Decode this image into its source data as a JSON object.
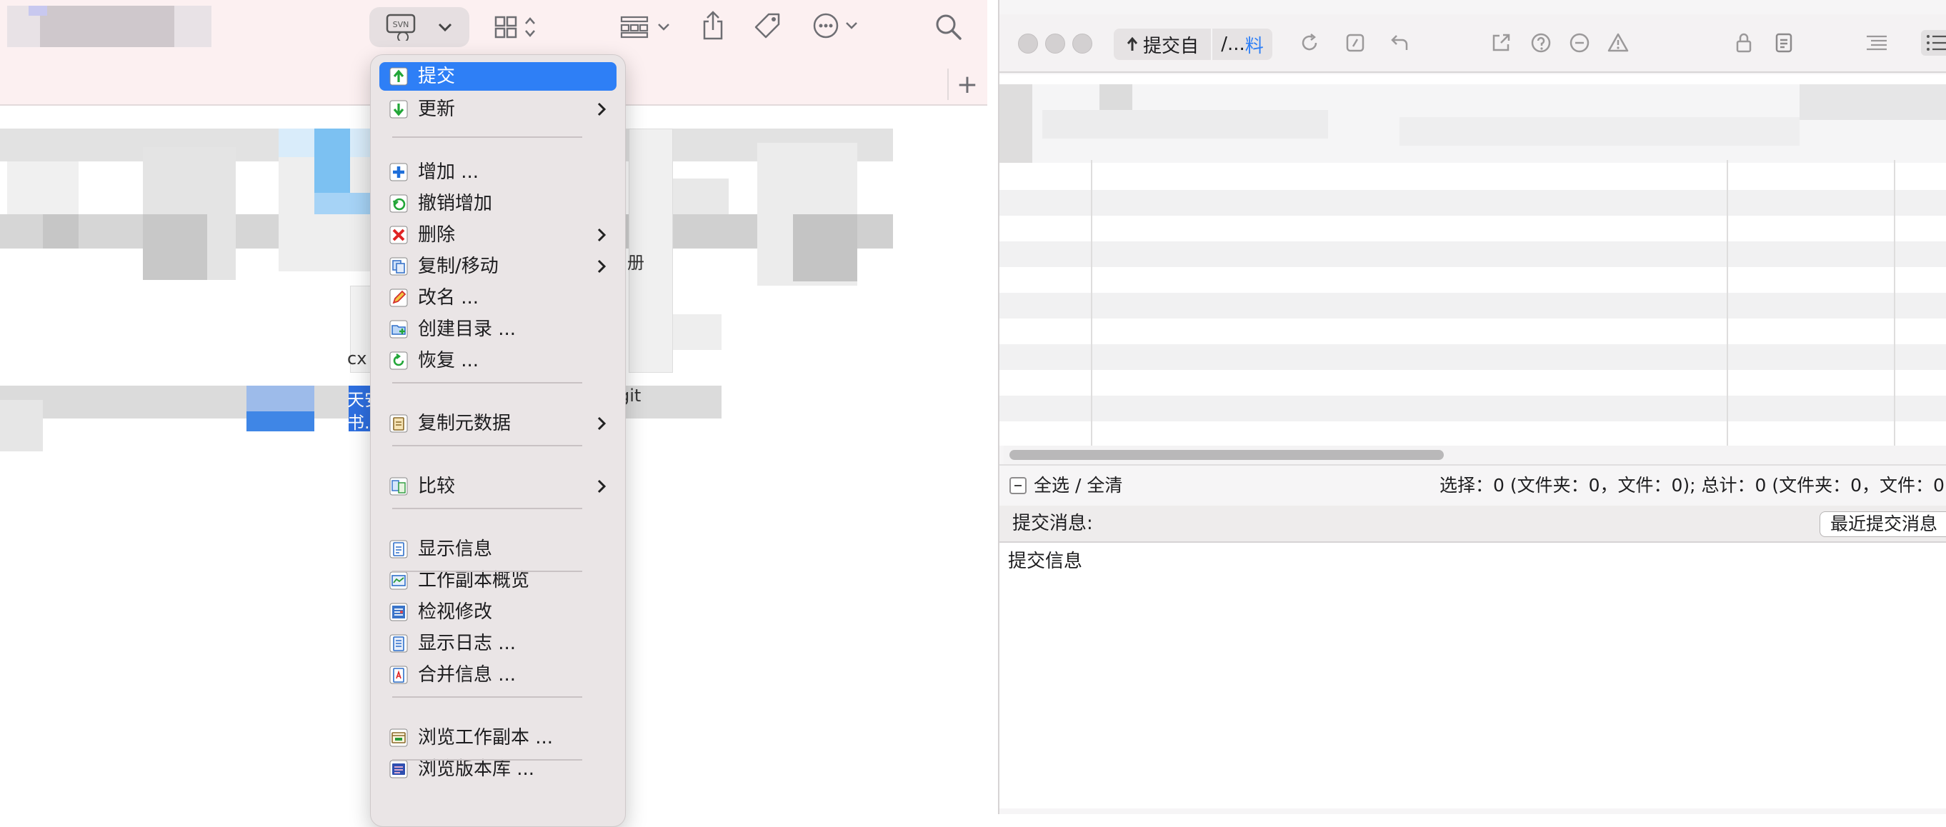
{
  "svn_menu": {
    "items": [
      {
        "label": "提交",
        "icon": "commit-up-arrow-icon",
        "submenu": false,
        "selected": true
      },
      {
        "label": "更新",
        "icon": "update-down-arrow-icon",
        "submenu": true
      },
      {
        "label": "增加 ...",
        "icon": "add-plus-icon",
        "submenu": false
      },
      {
        "label": "撤销增加",
        "icon": "undo-add-icon",
        "submenu": false
      },
      {
        "label": "删除",
        "icon": "delete-x-icon",
        "submenu": true
      },
      {
        "label": "复制/移动",
        "icon": "copy-move-icon",
        "submenu": true
      },
      {
        "label": "改名 ...",
        "icon": "rename-pencil-icon",
        "submenu": false
      },
      {
        "label": "创建目录 ...",
        "icon": "create-folder-icon",
        "submenu": false
      },
      {
        "label": "恢复 ...",
        "icon": "revert-icon",
        "submenu": false
      },
      {
        "label": "复制元数据",
        "icon": "copy-metadata-icon",
        "submenu": true
      },
      {
        "label": "比较",
        "icon": "compare-icon",
        "submenu": true
      },
      {
        "label": "显示信息",
        "icon": "show-info-icon",
        "submenu": false
      },
      {
        "label": "工作副本概览",
        "icon": "working-copy-overview-icon",
        "submenu": false
      },
      {
        "label": "检视修改",
        "icon": "review-changes-icon",
        "submenu": false
      },
      {
        "label": "显示日志 ...",
        "icon": "show-log-icon",
        "submenu": false
      },
      {
        "label": "合并信息 ...",
        "icon": "merge-info-icon",
        "submenu": false
      },
      {
        "label": "浏览工作副本 ...",
        "icon": "browse-working-copy-icon",
        "submenu": false
      },
      {
        "label": "浏览版本库 ...",
        "icon": "browse-repository-icon",
        "submenu": false
      }
    ]
  },
  "finder": {
    "svn_button_icon": "svn-badge-icon",
    "toolbar_icons": [
      "view-grid-icon",
      "group-by-icon",
      "share-icon",
      "tag-icon",
      "more-actions-icon",
      "search-icon"
    ],
    "new_tab_label": "+",
    "visible_fragments": [
      "天安",
      "书.",
      "册",
      "cx",
      "git"
    ]
  },
  "commit_window": {
    "commit_from_label": "提交自",
    "path_prefix": "/...",
    "path_link": "料",
    "select_all_label": "全选 / 全清",
    "selection_summary": "选择：0 (文件夹：0，文件：0); 总计：0 (文件夹：0，文件：0",
    "message_label": "提交消息:",
    "recent_messages_button": "最近提交消息",
    "message_text": "提交信息"
  },
  "colors": {
    "accent": "#2e7ff6",
    "finder_toolbar_bg": "#fcf0f1",
    "menu_bg": "#eae5e6"
  }
}
